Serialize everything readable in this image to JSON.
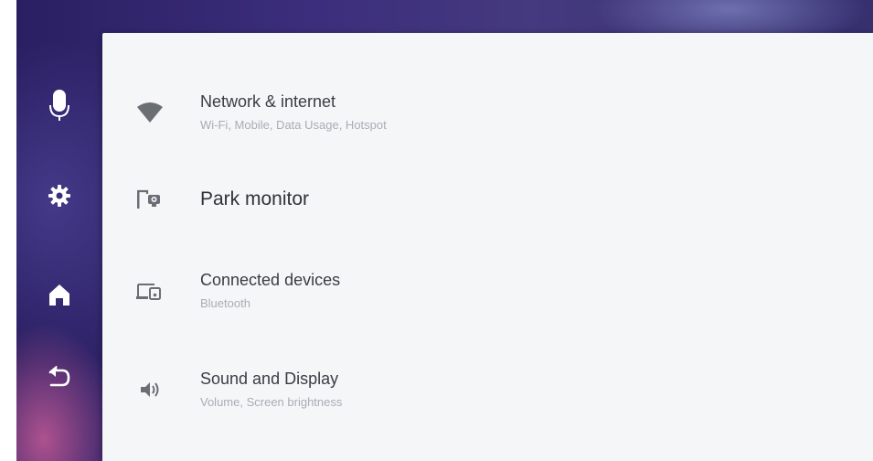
{
  "nav_rail": {
    "items": [
      {
        "icon": "microphone-icon"
      },
      {
        "icon": "gear-icon"
      },
      {
        "icon": "home-icon"
      },
      {
        "icon": "back-icon"
      }
    ]
  },
  "settings": {
    "items": [
      {
        "icon": "wifi-icon",
        "title": "Network & internet",
        "subtitle": "Wi-Fi, Mobile, Data Usage, Hotspot"
      },
      {
        "icon": "park-monitor-icon",
        "title": "Park monitor",
        "subtitle": ""
      },
      {
        "icon": "connected-devices-icon",
        "title": "Connected devices",
        "subtitle": "Bluetooth"
      },
      {
        "icon": "speaker-icon",
        "title": "Sound and Display",
        "subtitle": "Volume, Screen brightness"
      }
    ]
  },
  "colors": {
    "wallpaper": "#3c2e7c",
    "panel": "#f5f6f8",
    "title_text": "#3a3d44",
    "subtitle_text": "#a9adb3",
    "icon": "#6b6f75"
  }
}
